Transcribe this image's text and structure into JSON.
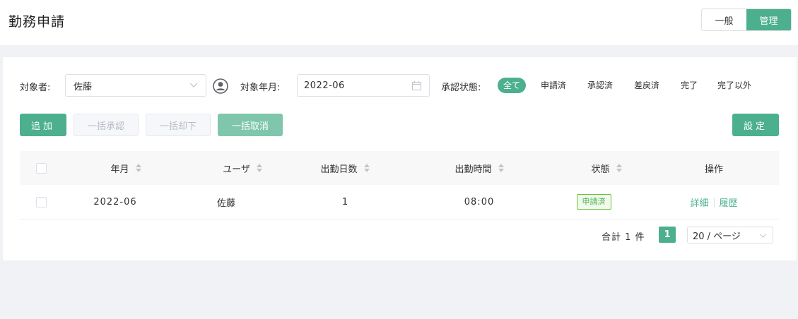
{
  "header": {
    "title": "勤務申請",
    "mode_general": "一般",
    "mode_admin": "管理"
  },
  "filters": {
    "target_user_label": "対象者:",
    "target_user_value": "佐藤",
    "target_month_label": "対象年月:",
    "target_month_value": "2022-06",
    "status_label": "承認状態:",
    "status_options": [
      "全て",
      "申請済",
      "承認済",
      "差戻済",
      "完了",
      "完了以外"
    ],
    "status_selected": "全て"
  },
  "toolbar": {
    "add_label": "追加",
    "bulk_approve_label": "一括承認",
    "bulk_reject_label": "一括却下",
    "bulk_cancel_label": "一括取消",
    "settings_label": "設定"
  },
  "table": {
    "columns": [
      "年月",
      "ユーザ",
      "出勤日数",
      "出勤時間",
      "状態",
      "操作"
    ],
    "rows": [
      {
        "month": "2022-06",
        "user": "佐藤",
        "days": "1",
        "hours": "08:00",
        "status": "申請済",
        "action_detail": "詳細",
        "action_history": "履歴"
      }
    ]
  },
  "pagination": {
    "total": "合計 1 件",
    "current_page": "1",
    "page_size": "20 / ページ"
  },
  "colors": {
    "accent": "#4caf8e",
    "status_tag": "#67c23a"
  }
}
